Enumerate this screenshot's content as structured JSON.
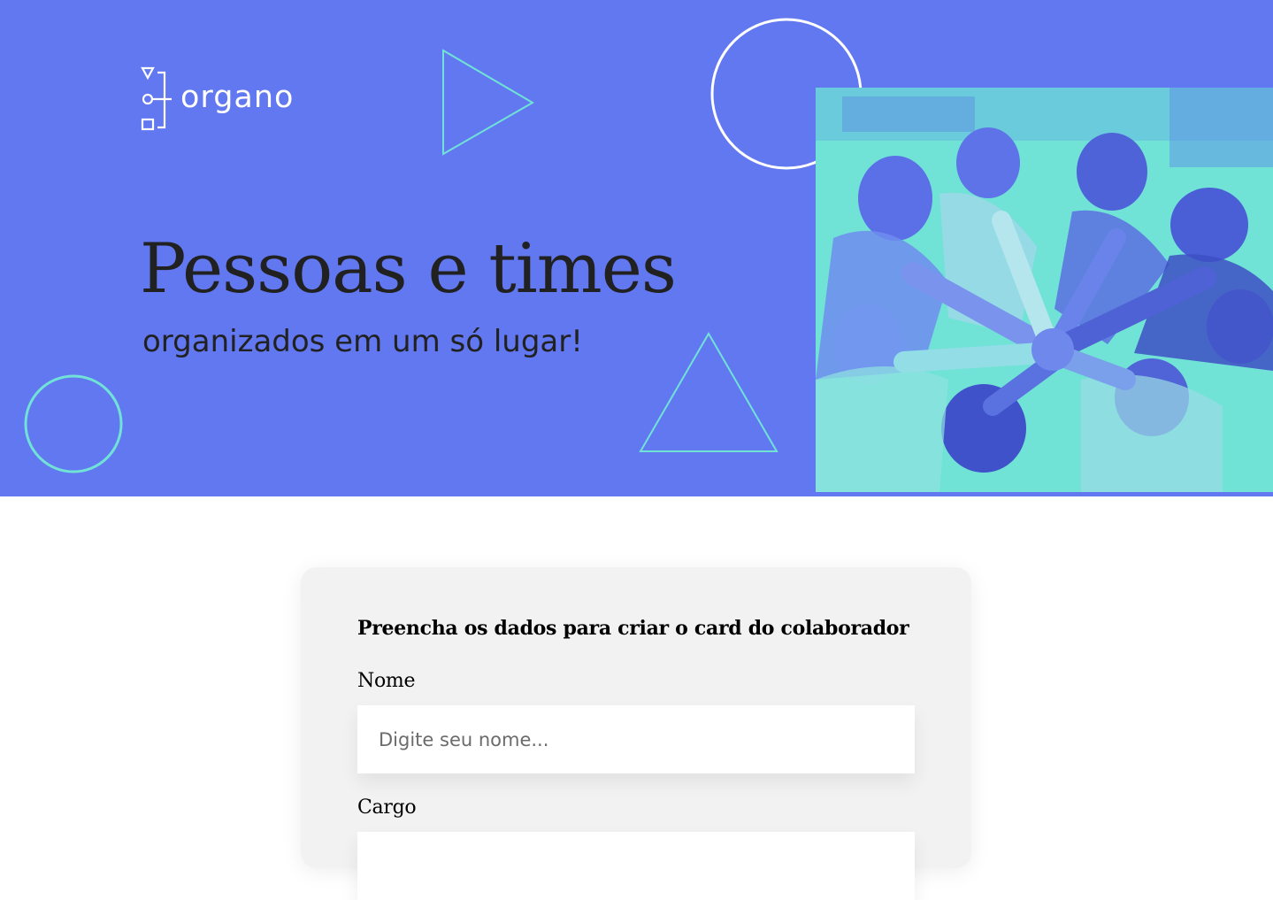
{
  "brand": {
    "name": "organo",
    "colors": {
      "banner": "#6278f0",
      "accent_cyan": "#71e2d6",
      "white": "#ffffff",
      "text_dark": "#212121",
      "card_bg": "#f2f2f2"
    }
  },
  "hero": {
    "title": "Pessoas e times",
    "subtitle": "organizados em um só lugar!",
    "image": "team-hands-together-photo"
  },
  "form": {
    "heading": "Preencha os dados para criar o card do colaborador",
    "fields": [
      {
        "label": "Nome",
        "placeholder": "Digite seu nome...",
        "value": ""
      },
      {
        "label": "Cargo",
        "placeholder": "",
        "value": ""
      }
    ]
  },
  "icons": {
    "logo": "organo-logo-icon",
    "decorations": [
      "triangle-outline-icon",
      "circle-outline-icon",
      "triangle-outline-icon",
      "circle-outline-icon"
    ]
  }
}
